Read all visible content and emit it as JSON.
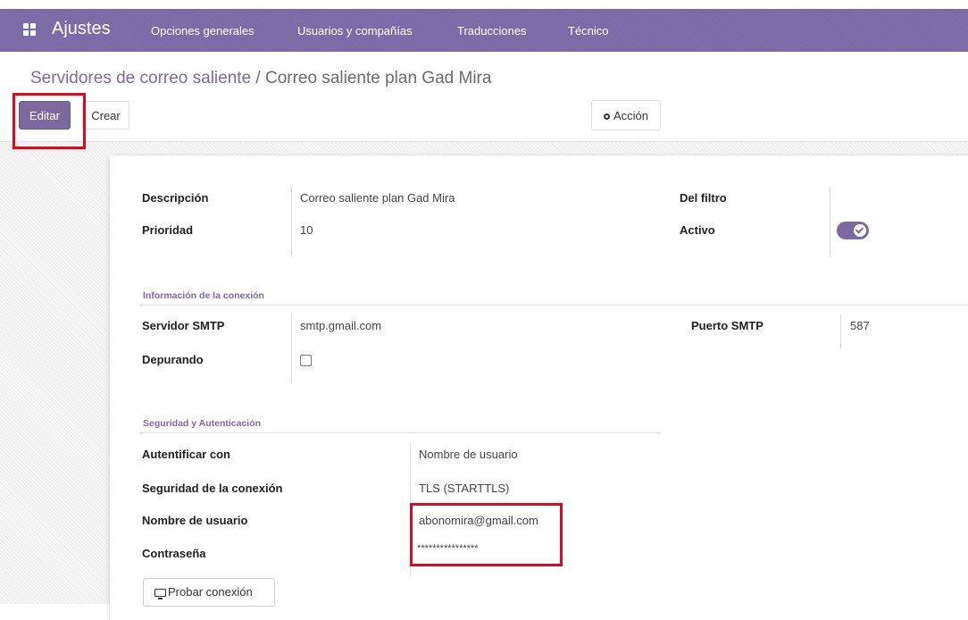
{
  "nav": {
    "app_title": "Ajustes",
    "menu": [
      "Opciones generales",
      "Usuarios y compañías",
      "Traducciones",
      "Técnico"
    ]
  },
  "breadcrumb": {
    "parent": "Servidores de correo saliente",
    "separator": "/",
    "current": "Correo saliente plan Gad Mira"
  },
  "toolbar": {
    "edit_label": "Editar",
    "create_label": "Crear",
    "action_label": "Acción"
  },
  "form": {
    "description_label": "Descripción",
    "description_value": "Correo saliente plan Gad Mira",
    "priority_label": "Prioridad",
    "priority_value": "10",
    "filter_label": "Del filtro",
    "active_label": "Activo",
    "active_value": true,
    "connection_section": "Información de la conexión",
    "smtp_server_label": "Servidor SMTP",
    "smtp_server_value": "smtp.gmail.com",
    "smtp_port_label": "Puerto SMTP",
    "smtp_port_value": "587",
    "debug_label": "Depurando",
    "debug_value": false,
    "security_section": "Seguridad y Autenticación",
    "auth_label": "Autentificar con",
    "auth_value": "Nombre de usuario",
    "conn_security_label": "Seguridad de la conexión",
    "conn_security_value": "TLS (STARTTLS)",
    "username_label": "Nombre de usuario",
    "username_value": "abonomira@gmail.com",
    "password_label": "Contraseña",
    "password_value": "****************",
    "test_button_label": "Probar conexión"
  },
  "colors": {
    "brand": "#7a6aa6",
    "primary_button": "#7c6a9f",
    "highlight": "#e0061e"
  },
  "icons": [
    "apps-grid-icon",
    "gear-icon",
    "checkmark-icon",
    "monitor-icon"
  ]
}
